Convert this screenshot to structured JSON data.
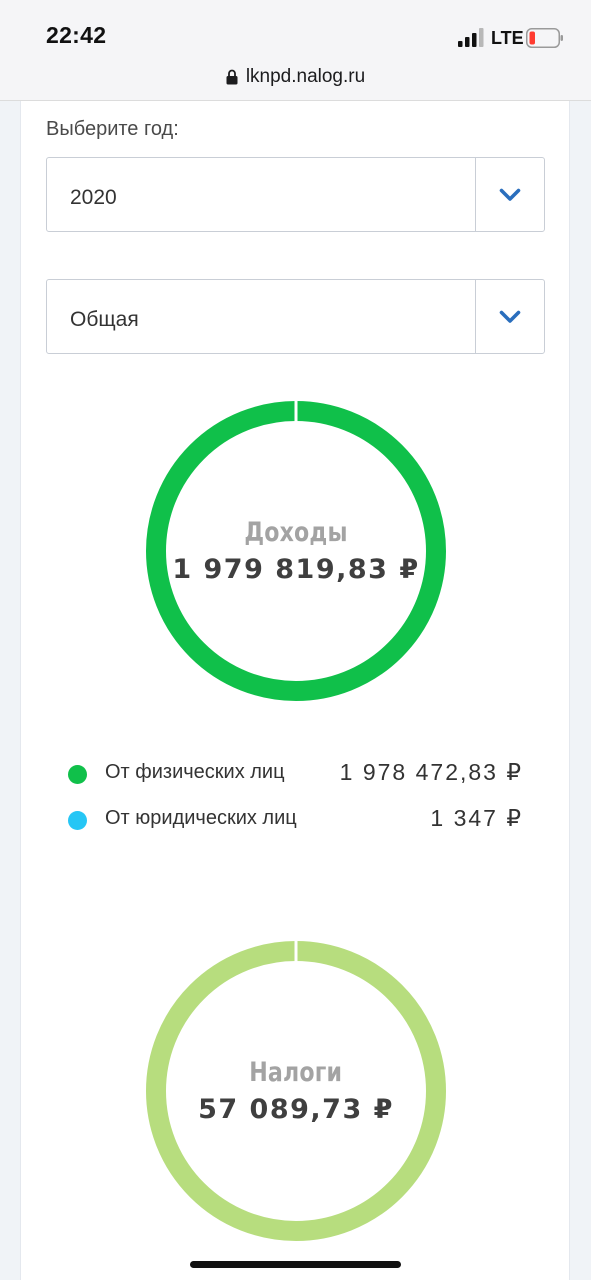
{
  "status_bar": {
    "time": "22:42",
    "network": "LTE",
    "icons": [
      "cellular-signal-icon",
      "battery-low-icon"
    ]
  },
  "browser": {
    "url": "lknpd.nalog.ru",
    "icons": [
      "lock-icon"
    ]
  },
  "filters": {
    "year_label": "Выберите год:",
    "year_value": "2020",
    "type_value": "Общая",
    "toggle_icon": "chevron-down-icon"
  },
  "income": {
    "title": "Доходы",
    "total": "1 979 819,83 ₽",
    "legend": [
      {
        "label": "От физических лиц",
        "value": "1 978 472,83 ₽",
        "amount": 1978472.83,
        "color": "#10c04a"
      },
      {
        "label": "От юридических лиц",
        "value": "1 347 ₽",
        "amount": 1347,
        "color": "#26c6f5"
      }
    ]
  },
  "taxes": {
    "title": "Налоги",
    "total": "57 089,73 ₽",
    "color": "#b7dd7e"
  },
  "colors": {
    "accent": "#2a6ebd",
    "income_green": "#10c04a",
    "legal_blue": "#26c6f5",
    "tax_green": "#b7dd7e"
  }
}
